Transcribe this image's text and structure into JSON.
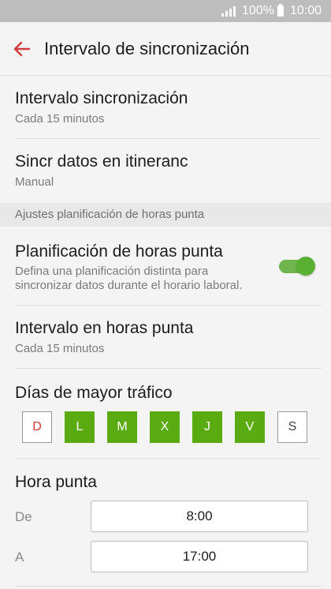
{
  "status_bar": {
    "battery": "100%",
    "time": "10:00"
  },
  "app_bar": {
    "title": "Intervalo de sincronización"
  },
  "sync_interval": {
    "title": "Intervalo sincronización",
    "value": "Cada 15 minutos"
  },
  "roaming": {
    "title": "Sincr datos en itineranc",
    "value": "Manual"
  },
  "section_header": "Ajustes planificación de horas punta",
  "peak_schedule": {
    "title": "Planificación de horas punta",
    "description_line1": "Defina una planificación distinta para",
    "description_line2": "sincronizar datos durante el horario laboral.",
    "enabled": true
  },
  "peak_interval": {
    "title": "Intervalo en horas punta",
    "value": "Cada 15 minutos"
  },
  "peak_days": {
    "title": "Días de mayor tráfico",
    "days": [
      {
        "label": "D",
        "selected": false
      },
      {
        "label": "L",
        "selected": true
      },
      {
        "label": "M",
        "selected": true
      },
      {
        "label": "X",
        "selected": true
      },
      {
        "label": "J",
        "selected": true
      },
      {
        "label": "V",
        "selected": true
      },
      {
        "label": "S",
        "selected": false
      }
    ]
  },
  "peak_hours": {
    "title": "Hora punta",
    "from_label": "De",
    "from_value": "8:00",
    "to_label": "A",
    "to_value": "17:00"
  },
  "colors": {
    "accent_green": "#5aaa12",
    "back_arrow_red": "#d23b3b",
    "status_bar": "#bdbdbd"
  }
}
